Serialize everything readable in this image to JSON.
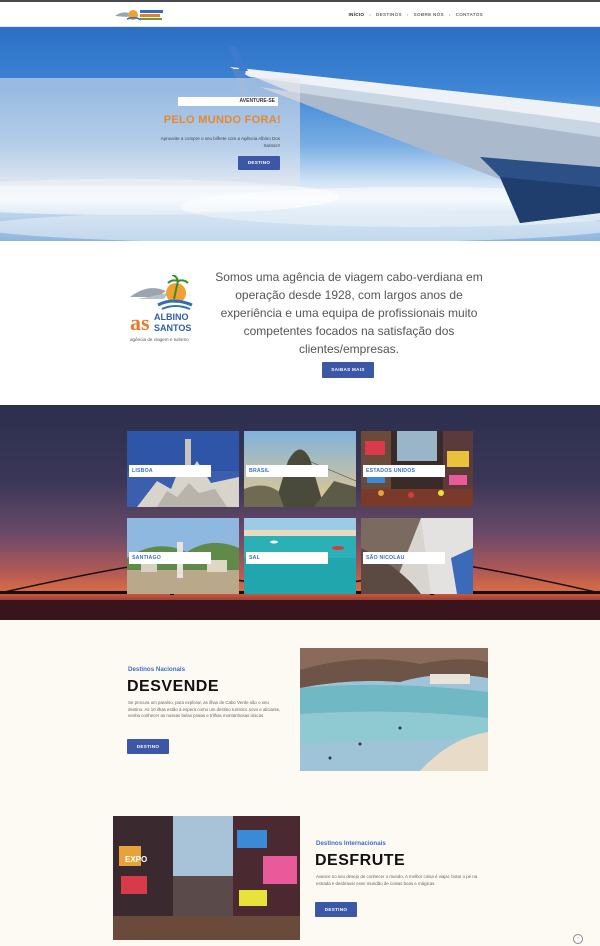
{
  "header": {
    "logo_alt": "Albino dos Santos",
    "nav": [
      "INÍCIO",
      "DESTINOS",
      "SOBRE NÓS",
      "CONTATOS"
    ]
  },
  "hero": {
    "tag": "AVENTURE-SE",
    "title": "PELO MUNDO FORA!",
    "text": "Aproveite a compre o seu bilhete com a Agência Albino Dos Santos!!",
    "button": "DESTINO"
  },
  "about": {
    "logo_text": "ALBINO dos SANTOS",
    "logo_sub": "agência de viagem e turismo",
    "text": "Somos uma agência de viagem cabo-verdiana em operação desde 1928, com largos anos de experiência e uma equipa de profissionais muito competentes focados na satisfação dos clientes/empresas.",
    "button": "SAIBAS MAIS"
  },
  "destinations": [
    {
      "label": "LISBOA"
    },
    {
      "label": "BRASIL"
    },
    {
      "label": "ESTADOS UNIDOS"
    },
    {
      "label": "SANTIAGO"
    },
    {
      "label": "SAL"
    },
    {
      "label": "SÃO NICOLAU"
    }
  ],
  "national": {
    "label": "Destinos Nacionais",
    "title": "DESVENDE",
    "text": "Se procura um paraíso, para explorar, as ilhas de Cabo Verde são o seu destino. As 10 ilhas estão à espera como um destino turístico novo e aliciante, venha conhecer as nossas belas praias e trilhas montanhosas únicas.",
    "button": "DESTINO"
  },
  "international": {
    "label": "Destinos Internacionais",
    "title": "DESFRUTE",
    "text": "Avance no seu desejo de conhecer o mundo. A melhor coisa é viajar, botar o pé na estrada e desbravar esse mundão de coisas boas e mágicas.",
    "button": "DESTINO"
  },
  "colors": {
    "accent": "#3b57a6",
    "orange": "#e8882a",
    "link_blue": "#3b6fc4"
  }
}
